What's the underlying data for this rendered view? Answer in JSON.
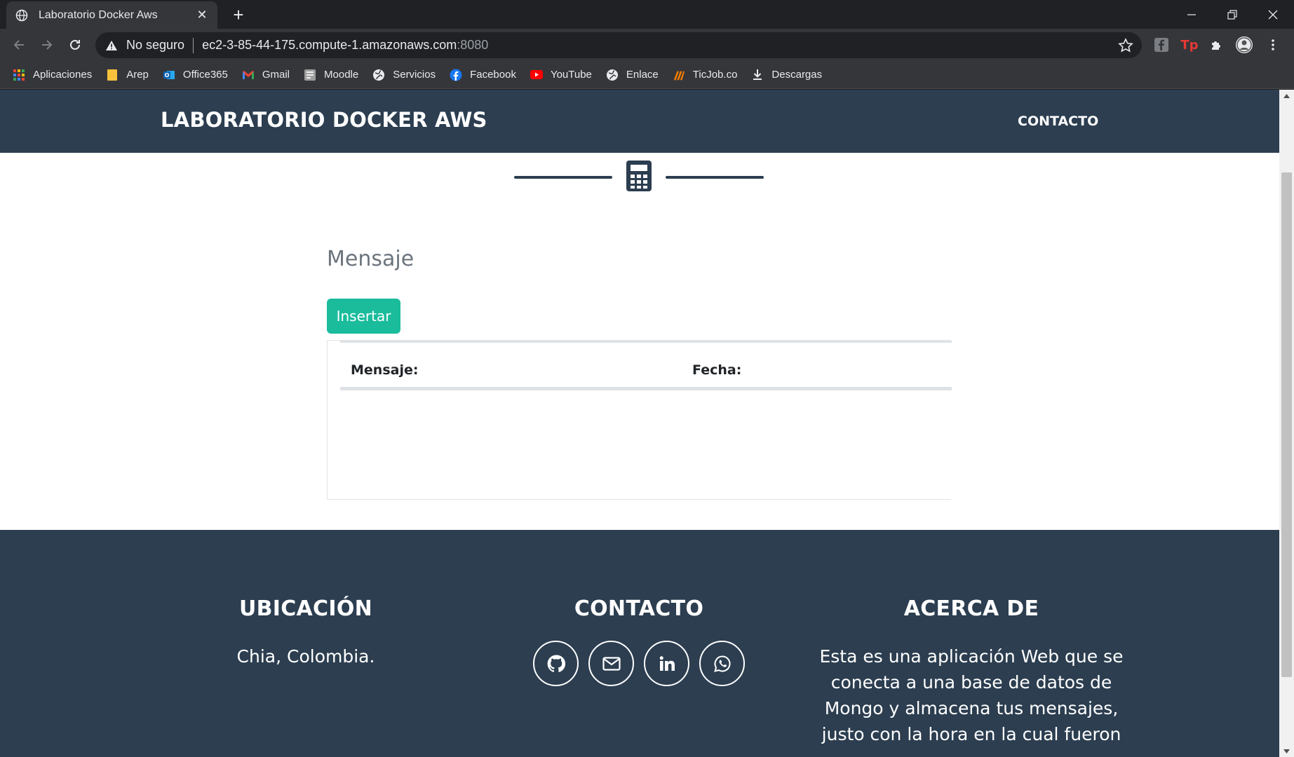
{
  "browser": {
    "tab_title": "Laboratorio Docker Aws",
    "security_label": "No seguro",
    "url_host": "ec2-3-85-44-175.compute-1.amazonaws.com",
    "url_port": ":8080",
    "bookmarks": [
      {
        "label": "Aplicaciones",
        "icon": "apps-grid-icon"
      },
      {
        "label": "Arep",
        "icon": "folder-icon"
      },
      {
        "label": "Office365",
        "icon": "outlook-icon"
      },
      {
        "label": "Gmail",
        "icon": "gmail-icon"
      },
      {
        "label": "Moodle",
        "icon": "moodle-icon"
      },
      {
        "label": "Servicios",
        "icon": "globe-icon"
      },
      {
        "label": "Facebook",
        "icon": "facebook-icon"
      },
      {
        "label": "YouTube",
        "icon": "youtube-icon"
      },
      {
        "label": "Enlace",
        "icon": "globe-icon"
      },
      {
        "label": "TicJob.co",
        "icon": "ticjob-icon"
      },
      {
        "label": "Descargas",
        "icon": "download-icon"
      }
    ]
  },
  "site": {
    "brand": "LABORATORIO DOCKER AWS",
    "nav_contact": "CONTACTO",
    "section_title": "Mensaje",
    "insert_button": "Insertar",
    "table": {
      "col_message": "Mensaje:",
      "col_date": "Fecha:"
    }
  },
  "footer": {
    "location_title": "UBICACIÓN",
    "location_text": "Chia, Colombia.",
    "contact_title": "CONTACTO",
    "about_title": "ACERCA DE",
    "about_text": "Esta es una aplicación Web que se conecta a una base de datos de Mongo y almacena tus mensajes, justo con la hora en la cual fueron"
  },
  "colors": {
    "nav_bg": "#2c3e50",
    "accent": "#1abc9c",
    "chrome_bg": "#35363a"
  }
}
